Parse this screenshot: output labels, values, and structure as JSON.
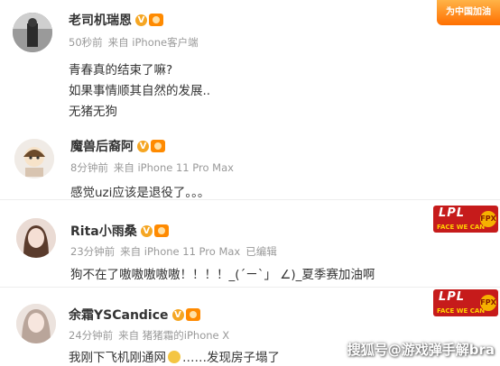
{
  "corner_badge": {
    "text": "为中国加油"
  },
  "comments": [
    {
      "username": "老司机瑞恩",
      "time": "50秒前",
      "source": "来自 iPhone客户端",
      "edited": "",
      "lines": [
        "青春真的结束了嘛?",
        "如果事情顺其自然的发展..",
        "无猪无狗"
      ]
    },
    {
      "username": "魔兽后裔阿",
      "time": "8分钟前",
      "source": "来自 iPhone 11 Pro Max",
      "edited": "",
      "lines": [
        "感觉uzi应该是退役了。。。"
      ]
    },
    {
      "username": "Rita小雨桑",
      "time": "23分钟前",
      "source": "来自 iPhone 11 Pro Max",
      "edited": "已编辑",
      "lines": [
        "狗不在了嗷嗷嗷嗷嗷！！！！_(´ㄧ`」 ∠)_夏季赛加油啊"
      ]
    },
    {
      "username": "余霜YSCandice",
      "time": "24分钟前",
      "source": "来自 猪猪霜的iPhone X",
      "edited": "",
      "lines": [
        "我刚下飞机刚通网",
        "……发现房子塌了"
      ]
    }
  ],
  "team_badge": {
    "big": "LPL",
    "small": "FACE WE CAN",
    "circle": "FPX"
  },
  "watermark": "搜狐号@游戏弹手解bra",
  "colors": {
    "username": "#333333",
    "meta": "#999999",
    "accent": "#f5a623",
    "badge_red": "#c61b1b"
  }
}
